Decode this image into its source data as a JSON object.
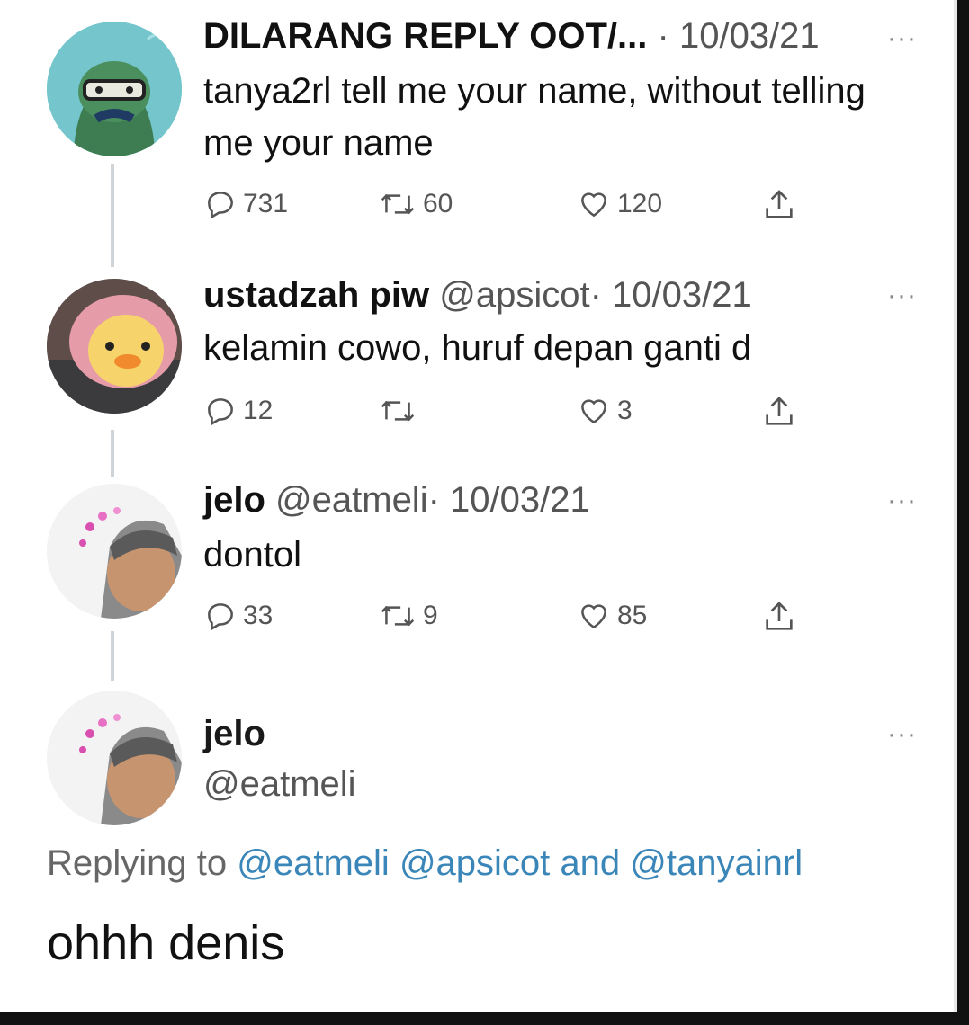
{
  "tweets": [
    {
      "name": "DILARANG REPLY OOT/...",
      "handle": "",
      "date": "· 10/03/21",
      "text": "tanya2rl tell me your name, without telling me your name",
      "stats": {
        "replies": "731",
        "retweets": "60",
        "likes": "120"
      }
    },
    {
      "name": "ustadzah piw",
      "handle": "@apsicot",
      "date": "· 10/03/21",
      "text": "kelamin cowo, huruf depan ganti d",
      "stats": {
        "replies": "12",
        "retweets": "",
        "likes": "3"
      }
    },
    {
      "name": "jelo",
      "handle": "@eatmeli",
      "date": "· 10/03/21",
      "text": "dontol",
      "stats": {
        "replies": "33",
        "retweets": "9",
        "likes": "85"
      }
    }
  ],
  "main_tweet": {
    "name": "jelo",
    "handle": "@eatmeli",
    "replying_prefix": "Replying to",
    "replying_to_1": "@eatmeli",
    "replying_to_2": "@apsicot",
    "replying_and": "and",
    "replying_to_3": "@tanyainrl",
    "text": "ohhh denis"
  },
  "more_label": "···",
  "colors": {
    "link": "#3a86b8",
    "thread_line": "#cfd4d8",
    "meta": "#555555"
  },
  "icons": [
    "reply-icon",
    "retweet-icon",
    "like-icon",
    "share-icon",
    "more-icon"
  ]
}
